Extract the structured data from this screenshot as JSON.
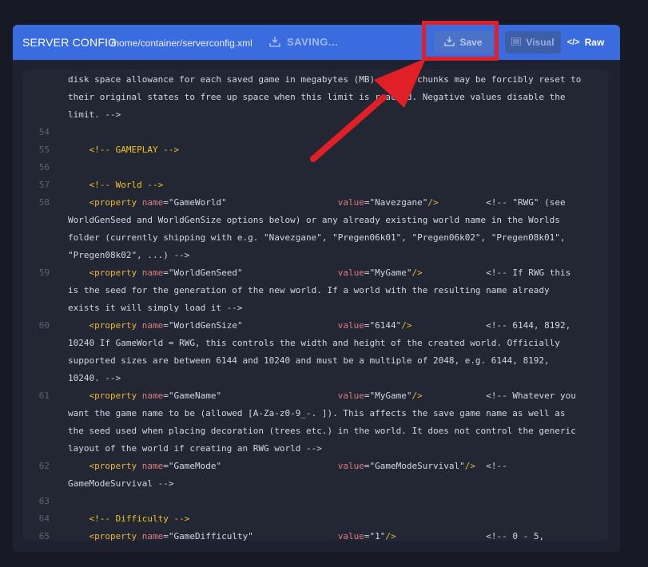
{
  "header": {
    "title": "SERVER CONFIG",
    "path": "/home/container/serverconfig.xml",
    "status": "SAVING...",
    "save_label": "Save",
    "visual_label": "Visual",
    "raw_label": "Raw"
  },
  "editor": {
    "lines": [
      {
        "num": "",
        "text": "disk space allowance for each saved game in megabytes (MB). Saved chunks may be forcibly reset to"
      },
      {
        "num": "",
        "text": "their original states to free up space when this limit is reached. Negative values disable the"
      },
      {
        "num": "",
        "text": "limit. -->"
      },
      {
        "num": "54",
        "text": ""
      },
      {
        "num": "55",
        "text": "    <!-- GAMEPLAY -->"
      },
      {
        "num": "56",
        "text": ""
      },
      {
        "num": "57",
        "text": "    <!-- World -->"
      },
      {
        "num": "58",
        "text": "    <property name=\"GameWorld\"                     value=\"Navezgane\"/>         <!-- \"RWG\" (see"
      },
      {
        "num": "",
        "text": "WorldGenSeed and WorldGenSize options below) or any already existing world name in the Worlds"
      },
      {
        "num": "",
        "text": "folder (currently shipping with e.g. \"Navezgane\", \"Pregen06k01\", \"Pregen06k02\", \"Pregen08k01\","
      },
      {
        "num": "",
        "text": "\"Pregen08k02\", ...) -->"
      },
      {
        "num": "59",
        "text": "    <property name=\"WorldGenSeed\"                  value=\"MyGame\"/>            <!-- If RWG this"
      },
      {
        "num": "",
        "text": "is the seed for the generation of the new world. If a world with the resulting name already"
      },
      {
        "num": "",
        "text": "exists it will simply load it -->"
      },
      {
        "num": "60",
        "text": "    <property name=\"WorldGenSize\"                  value=\"6144\"/>              <!-- 6144, 8192,"
      },
      {
        "num": "",
        "text": "10240 If GameWorld = RWG, this controls the width and height of the created world. Officially"
      },
      {
        "num": "",
        "text": "supported sizes are between 6144 and 10240 and must be a multiple of 2048, e.g. 6144, 8192,"
      },
      {
        "num": "",
        "text": "10240. -->"
      },
      {
        "num": "61",
        "text": "    <property name=\"GameName\"                      value=\"MyGame\"/>            <!-- Whatever you"
      },
      {
        "num": "",
        "text": "want the game name to be (allowed [A-Za-z0-9_-. ]). This affects the save game name as well as"
      },
      {
        "num": "",
        "text": "the seed used when placing decoration (trees etc.) in the world. It does not control the generic"
      },
      {
        "num": "",
        "text": "layout of the world if creating an RWG world -->"
      },
      {
        "num": "62",
        "text": "    <property name=\"GameMode\"                      value=\"GameModeSurvival\"/>  <!--"
      },
      {
        "num": "",
        "text": "GameModeSurvival -->"
      },
      {
        "num": "63",
        "text": ""
      },
      {
        "num": "64",
        "text": "    <!-- Difficulty -->"
      },
      {
        "num": "65",
        "text": "    <property name=\"GameDifficulty\"                value=\"1\"/>                 <!-- 0 - 5,"
      }
    ]
  },
  "icons": {
    "status": "save-icon",
    "save": "save-icon",
    "visual": "list-icon",
    "raw": "code-icon"
  },
  "colors": {
    "header": "#3a6ce0",
    "comment": "#f0c419",
    "tag": "#e8b63c",
    "attr": "#e07a7f",
    "string": "#d2d6de",
    "highlight": "#e01f26"
  }
}
